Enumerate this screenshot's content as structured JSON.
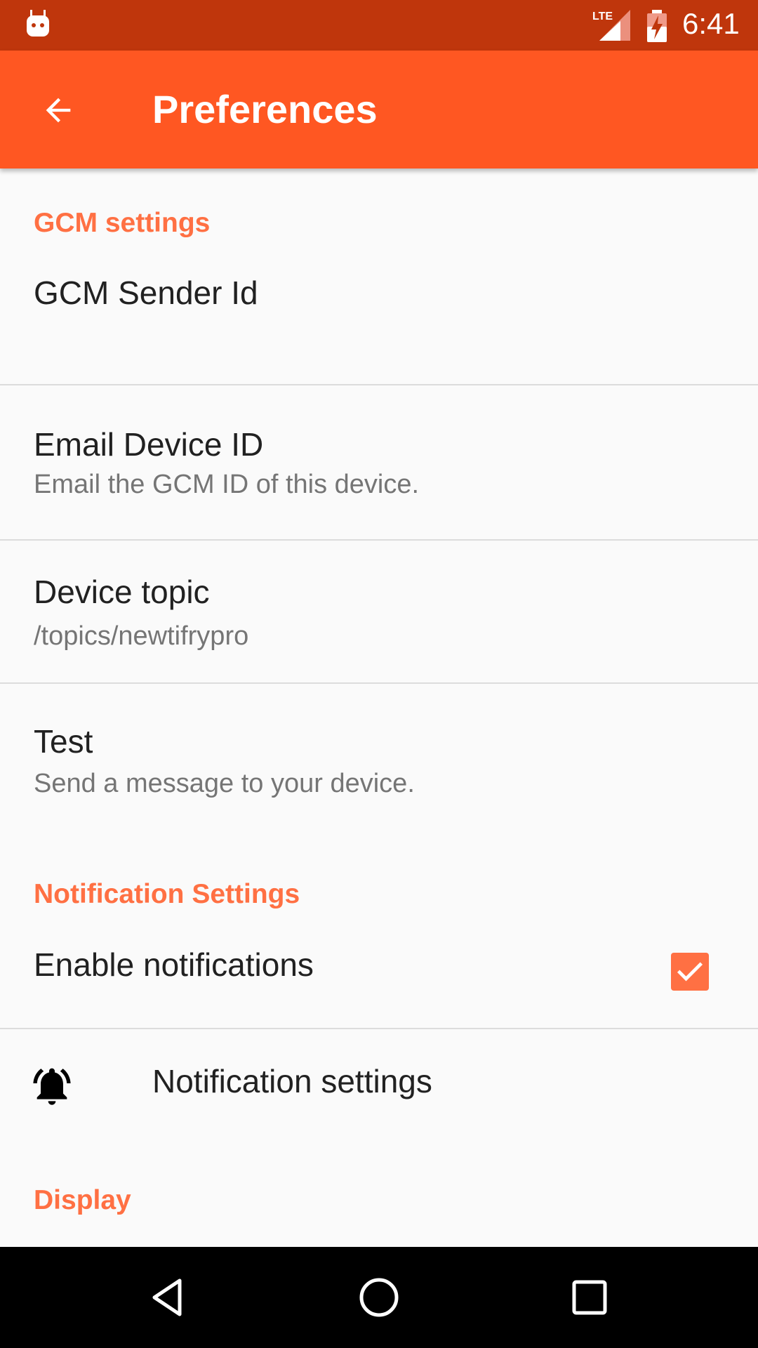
{
  "status_bar": {
    "network_label": "LTE",
    "time": "6:41"
  },
  "app_bar": {
    "title": "Preferences",
    "back_icon": "arrow-back-icon"
  },
  "sections": [
    {
      "header": "GCM settings",
      "items": [
        {
          "title": "GCM Sender Id",
          "summary": ""
        },
        {
          "title": "Email Device ID",
          "summary": "Email the GCM ID of this device."
        },
        {
          "title": "Device topic",
          "summary": "/topics/newtifrypro"
        },
        {
          "title": "Test",
          "summary": "Send a message to your device."
        }
      ]
    },
    {
      "header": "Notification Settings",
      "items": [
        {
          "title": "Enable notifications",
          "checked": true
        },
        {
          "title": "Notification settings",
          "icon": "bell-icon"
        }
      ]
    },
    {
      "header": "Display",
      "items": []
    }
  ],
  "colors": {
    "status_bar": "#bf360c",
    "app_bar": "#ff5722",
    "accent": "#ff7043",
    "background": "#fafafa"
  },
  "nav_bar": {
    "buttons": [
      "back-triangle-icon",
      "home-circle-icon",
      "recents-square-icon"
    ]
  }
}
